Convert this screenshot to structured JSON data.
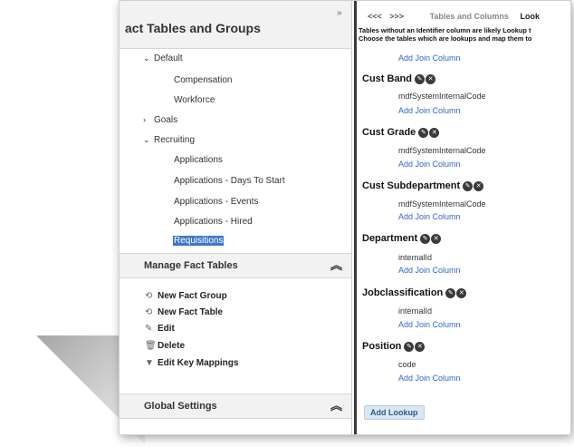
{
  "left": {
    "title": "act Tables and Groups",
    "tree": [
      {
        "label": "Default",
        "level": 0,
        "caret": "down"
      },
      {
        "label": "Compensation",
        "level": 1
      },
      {
        "label": "Workforce",
        "level": 1
      },
      {
        "label": "Goals",
        "level": 0,
        "caret": "right"
      },
      {
        "label": "Recruiting",
        "level": 0,
        "caret": "down"
      },
      {
        "label": "Applications",
        "level": 1
      },
      {
        "label": "Applications - Days To Start",
        "level": 1
      },
      {
        "label": "Applications - Events",
        "level": 1
      },
      {
        "label": "Applications - Hired",
        "level": 1
      },
      {
        "label": "Requisitions",
        "level": 1,
        "selected": true
      }
    ],
    "manage": {
      "title": "Manage Fact Tables",
      "actions": [
        {
          "label": "New Fact Group",
          "icon": "new-group-icon"
        },
        {
          "label": "New Fact Table",
          "icon": "new-table-icon"
        },
        {
          "label": "Edit",
          "icon": "pencil-icon"
        },
        {
          "label": "Delete",
          "icon": "trash-icon"
        },
        {
          "label": "Edit Key Mappings",
          "icon": "filter-icon"
        }
      ]
    },
    "global": {
      "title": "Global Settings"
    }
  },
  "right": {
    "nav_prev": "<<<",
    "nav_next": ">>>",
    "tab1": "Tables and Columns",
    "tab2": "Look",
    "desc_line1": "Tables without an Identifier column are likely Lookup t",
    "desc_line2": "Choose the tables which are lookups and map them to",
    "top_link": "Add Join Column",
    "tables": [
      {
        "name": "Cust Band",
        "column": "mdfSystemInternalCode",
        "link": "Add Join Column"
      },
      {
        "name": "Cust Grade",
        "column": "mdfSystemInternalCode",
        "link": "Add Join Column"
      },
      {
        "name": "Cust Subdepartment",
        "column": "mdfSystemInternalCode",
        "link": "Add Join Column"
      },
      {
        "name": "Department",
        "column": "internalId",
        "link": "Add Join Column"
      },
      {
        "name": "Jobclassification",
        "column": "internalId",
        "link": "Add Join Column"
      },
      {
        "name": "Position",
        "column": "code",
        "link": "Add Join Column"
      }
    ],
    "add_lookup": "Add Lookup"
  },
  "colors": {
    "selected": "#3b79c9",
    "link": "#3366cc",
    "header_bg": "#f2f2f2"
  }
}
